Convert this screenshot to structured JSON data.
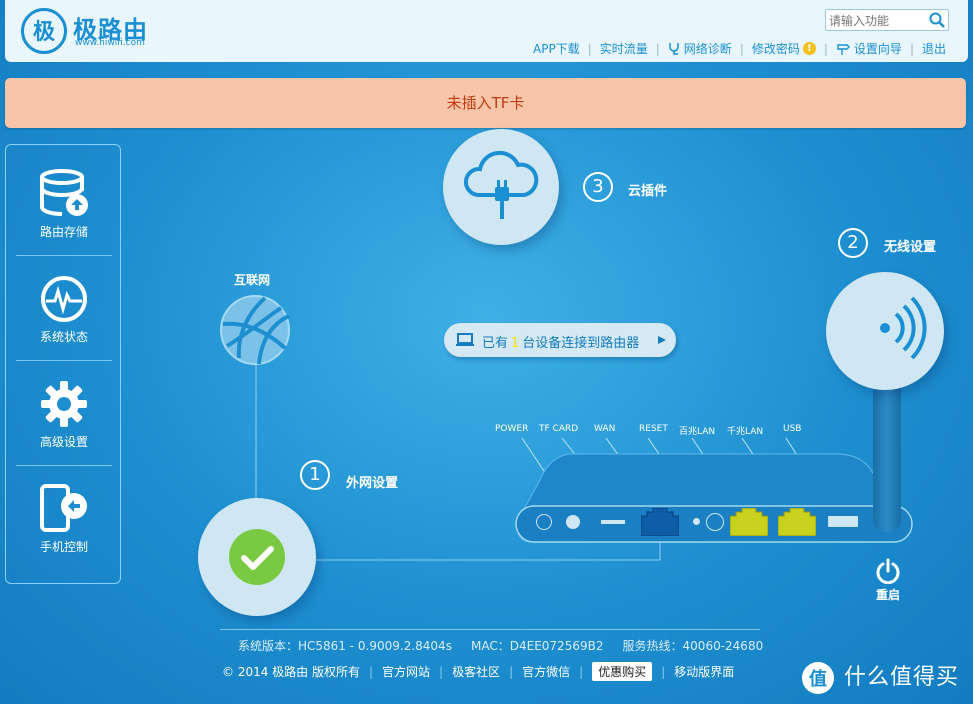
{
  "header": {
    "brand": "极路由",
    "url": "www.hiwifi.com",
    "search_placeholder": "请输入功能",
    "nav": [
      {
        "label": "APP下载"
      },
      {
        "label": "实时流量"
      },
      {
        "label": "网络诊断"
      },
      {
        "label": "修改密码"
      },
      {
        "label": "设置向导"
      },
      {
        "label": "退出"
      }
    ]
  },
  "banner": {
    "text": "未插入TF卡"
  },
  "sidebar": {
    "items": [
      {
        "label": "路由存储",
        "icon": "storage-icon"
      },
      {
        "label": "系统状态",
        "icon": "pulse-icon"
      },
      {
        "label": "高级设置",
        "icon": "gear-icon"
      },
      {
        "label": "手机控制",
        "icon": "phone-icon"
      }
    ]
  },
  "diagram": {
    "internet_label": "互联网",
    "wan": {
      "num": "1",
      "label": "外网设置"
    },
    "wireless": {
      "num": "2",
      "label": "无线设置"
    },
    "cloud": {
      "num": "3",
      "label": "云插件"
    },
    "devices": {
      "prefix": "已有",
      "count": "1",
      "suffix": "台设备连接到路由器"
    },
    "ports": [
      "POWER",
      "TF CARD",
      "WAN",
      "RESET",
      "百兆LAN",
      "千兆LAN",
      "USB"
    ],
    "reboot_label": "重启"
  },
  "footer": {
    "info": "系统版本：HC5861 - 0.9009.2.8404s     MAC：D4EE072569B2     服务热线：40060-24680",
    "copyright": "© 2014 极路由 版权所有",
    "links": [
      "官方网站",
      "极客社区",
      "官方微信"
    ],
    "promo": "优惠购买",
    "mobile": "移动版界面"
  },
  "watermark": {
    "text": "什么值得买"
  },
  "colors": {
    "accent": "#1a8fd3",
    "banner_bg": "#f9c5a8",
    "banner_text": "#c13b12",
    "ok_green": "#7ac943",
    "lan_yellow": "#c8d21e"
  }
}
